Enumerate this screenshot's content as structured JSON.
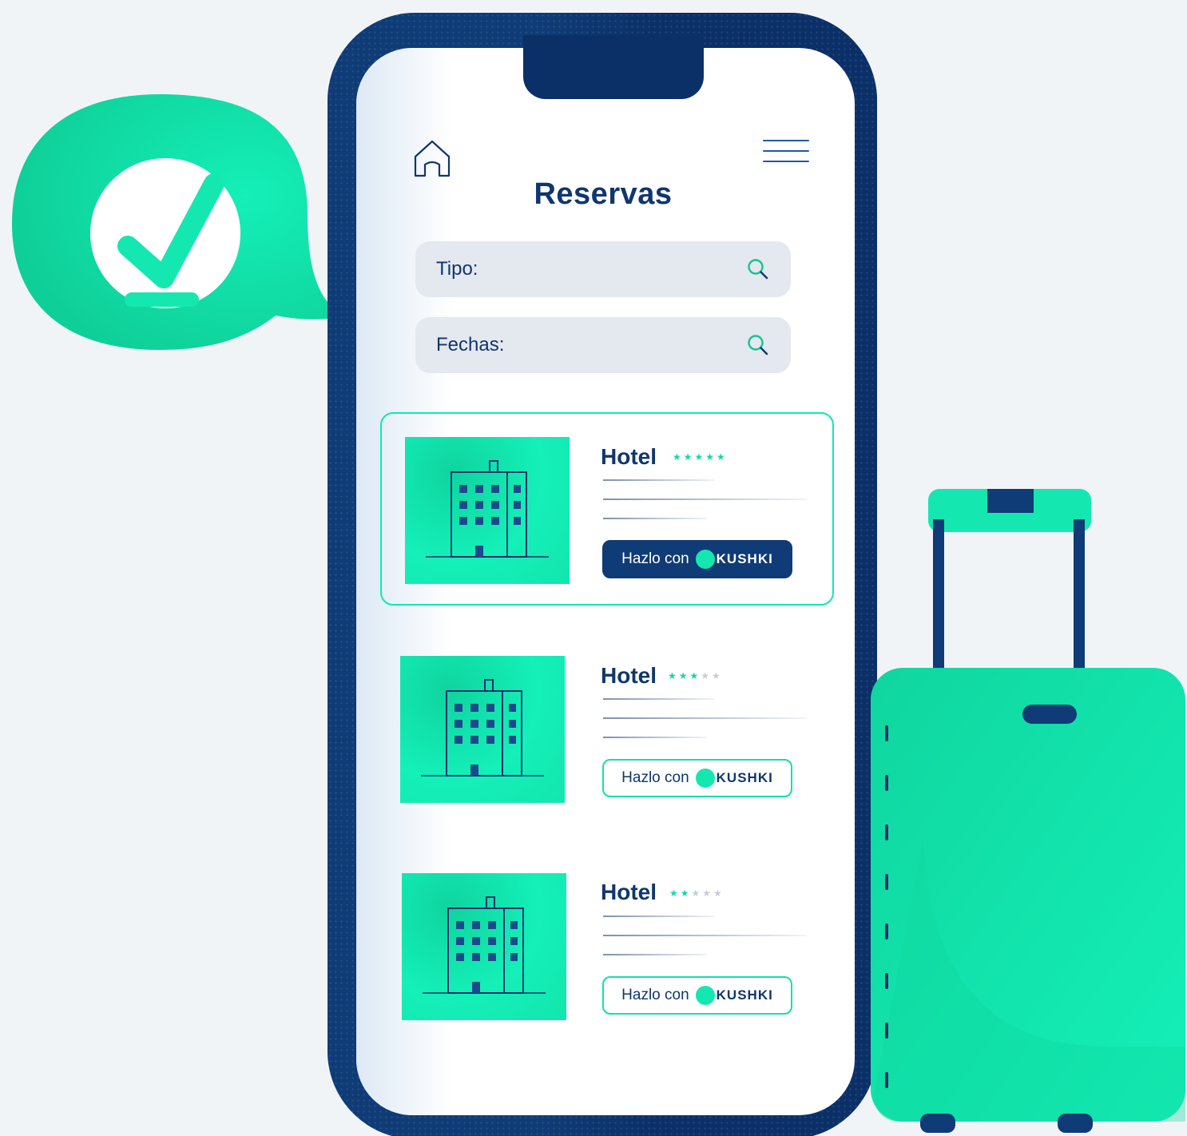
{
  "screen": {
    "title": "Reservas",
    "home_icon": "home-icon",
    "menu_icon": "hamburger-menu-icon"
  },
  "search_fields": [
    {
      "label": "Tipo:",
      "icon": "search-icon"
    },
    {
      "label": "Fechas:",
      "icon": "search-icon"
    }
  ],
  "hotels": [
    {
      "name": "Hotel",
      "stars_filled": 5,
      "stars_total": 5,
      "cta_label": "Hazlo con",
      "brand": "KUSHKI",
      "selected": true
    },
    {
      "name": "Hotel",
      "stars_filled": 3,
      "stars_total": 5,
      "cta_label": "Hazlo con",
      "brand": "KUSHKI",
      "selected": false
    },
    {
      "name": "Hotel",
      "stars_filled": 2,
      "stars_total": 5,
      "cta_label": "Hazlo con",
      "brand": "KUSHKI",
      "selected": false
    }
  ],
  "decorations": {
    "bubble_icon": "checkmark-download-icon",
    "suitcase": "suitcase-illustration"
  },
  "colors": {
    "background": "#f1f4f7",
    "phone_frame": "#0f3b76",
    "accent": "#14f0b8",
    "text_primary": "#10366e"
  }
}
